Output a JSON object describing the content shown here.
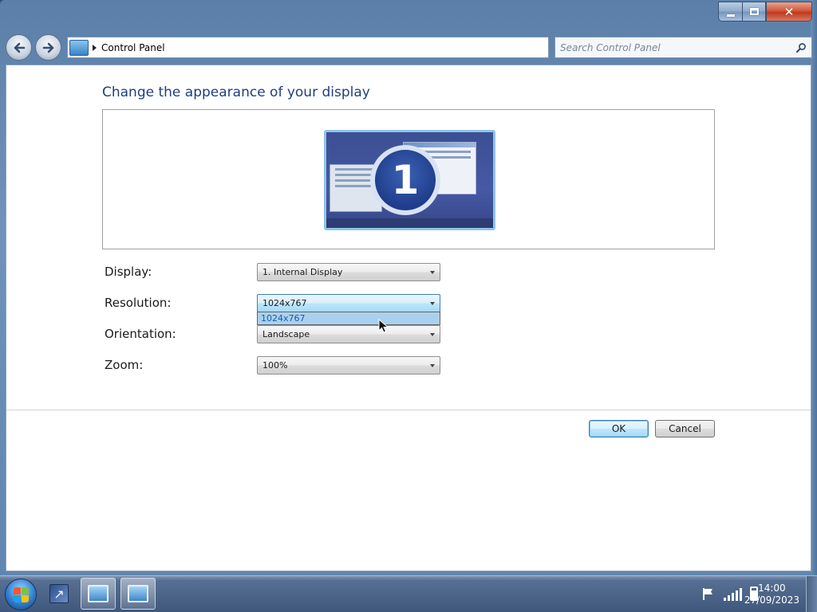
{
  "window": {
    "caption": {
      "close_label": "✕"
    }
  },
  "navigation": {
    "back_icon": "back-arrow-icon",
    "forward_icon": "forward-arrow-icon"
  },
  "address_bar": {
    "icon": "control-panel-icon",
    "path": "Control Panel"
  },
  "search": {
    "placeholder": "Search Control Panel",
    "icon": "search-icon"
  },
  "page": {
    "title": "Change the appearance of your display",
    "preview": {
      "monitor_number": "1"
    }
  },
  "form": {
    "display": {
      "label": "Display:",
      "value": "1. Internal Display"
    },
    "resolution": {
      "label": "Resolution:",
      "value": "1024x767",
      "dropdown_open": true,
      "options": [
        "1024x767"
      ]
    },
    "orientation": {
      "label": "Orientation:",
      "value": "Landscape"
    },
    "zoom": {
      "label": "Zoom:",
      "value": "100%"
    }
  },
  "buttons": {
    "ok": "OK",
    "cancel": "Cancel"
  },
  "taskbar": {
    "apps": [
      "shortcut-icon",
      "display-settings-icon",
      "control-panel-icon"
    ],
    "tray_icons": [
      "action-center-flag-icon",
      "network-signal-icon",
      "battery-icon"
    ],
    "clock": {
      "time": "14:00",
      "date": "27/09/2023"
    }
  },
  "colors": {
    "title_text": "#1f3e80",
    "selection_highlight": "#a9d1ef",
    "close_button": "#c0391d"
  }
}
